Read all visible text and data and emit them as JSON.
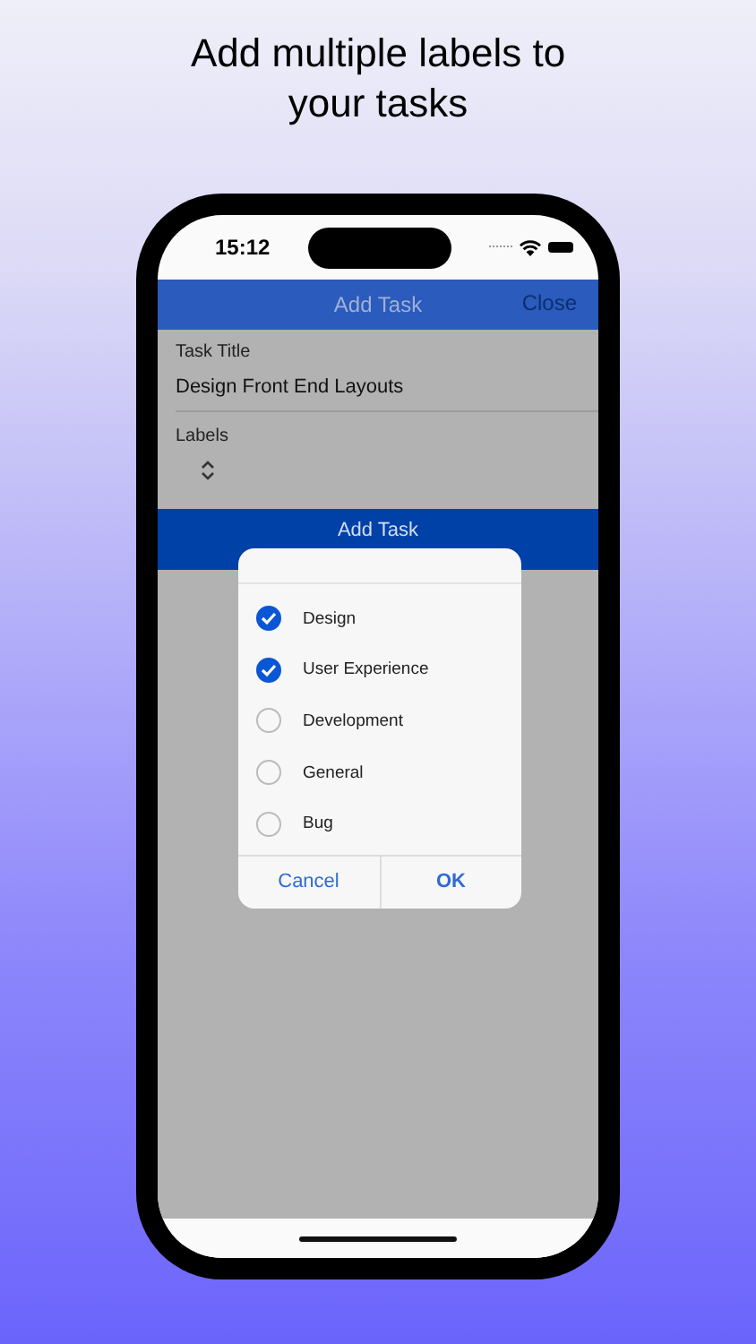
{
  "headline": "Add multiple labels to your tasks",
  "status_bar": {
    "time": "15:12"
  },
  "nav_bar": {
    "title": "Add Task",
    "close": "Close"
  },
  "form": {
    "title_label": "Task Title",
    "title_value": "Design Front End Layouts",
    "labels_label": "Labels",
    "submit": "Add Task"
  },
  "dialog": {
    "options": [
      {
        "label": "Design",
        "checked": true
      },
      {
        "label": "User Experience",
        "checked": true
      },
      {
        "label": "Development",
        "checked": false
      },
      {
        "label": "General",
        "checked": false
      },
      {
        "label": "Bug",
        "checked": false
      }
    ],
    "cancel": "Cancel",
    "ok": "OK"
  }
}
